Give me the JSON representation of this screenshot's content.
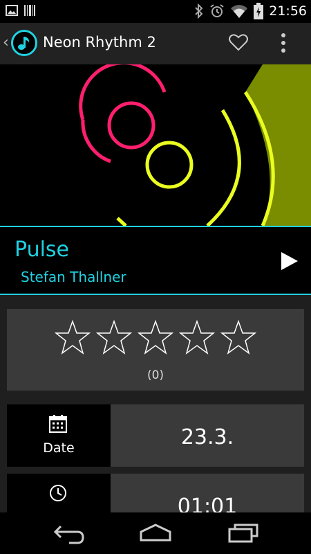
{
  "status_bar": {
    "time": "21:56",
    "icons": [
      "image-icon",
      "barcode-icon",
      "bluetooth-icon",
      "alarm-icon",
      "wifi-icon",
      "battery-icon"
    ]
  },
  "action_bar": {
    "title": "Neon Rhythm 2",
    "up_glyph": "‹",
    "icons": [
      "music-note-icon",
      "heart-icon",
      "overflow-menu-icon"
    ]
  },
  "track": {
    "title": "Pulse",
    "artist": "Stefan Thallner"
  },
  "rating": {
    "stars_total": 5,
    "stars_filled": 0,
    "count_label": "(0)"
  },
  "details": [
    {
      "label": "Date",
      "value": "23.3.",
      "icon": "calendar-icon"
    },
    {
      "label": "",
      "value": "01:01",
      "icon": "clock-icon"
    }
  ],
  "colors": {
    "accent": "#1fd2e2",
    "artwork_pink": "#ff1f6e",
    "artwork_yellow": "#eaff1f",
    "artwork_olive": "#7a8c00",
    "card": "#3a3a3a",
    "background": "#1f1f1f"
  },
  "nav_bar": {
    "icons": [
      "back-icon",
      "home-icon",
      "recents-icon"
    ]
  }
}
